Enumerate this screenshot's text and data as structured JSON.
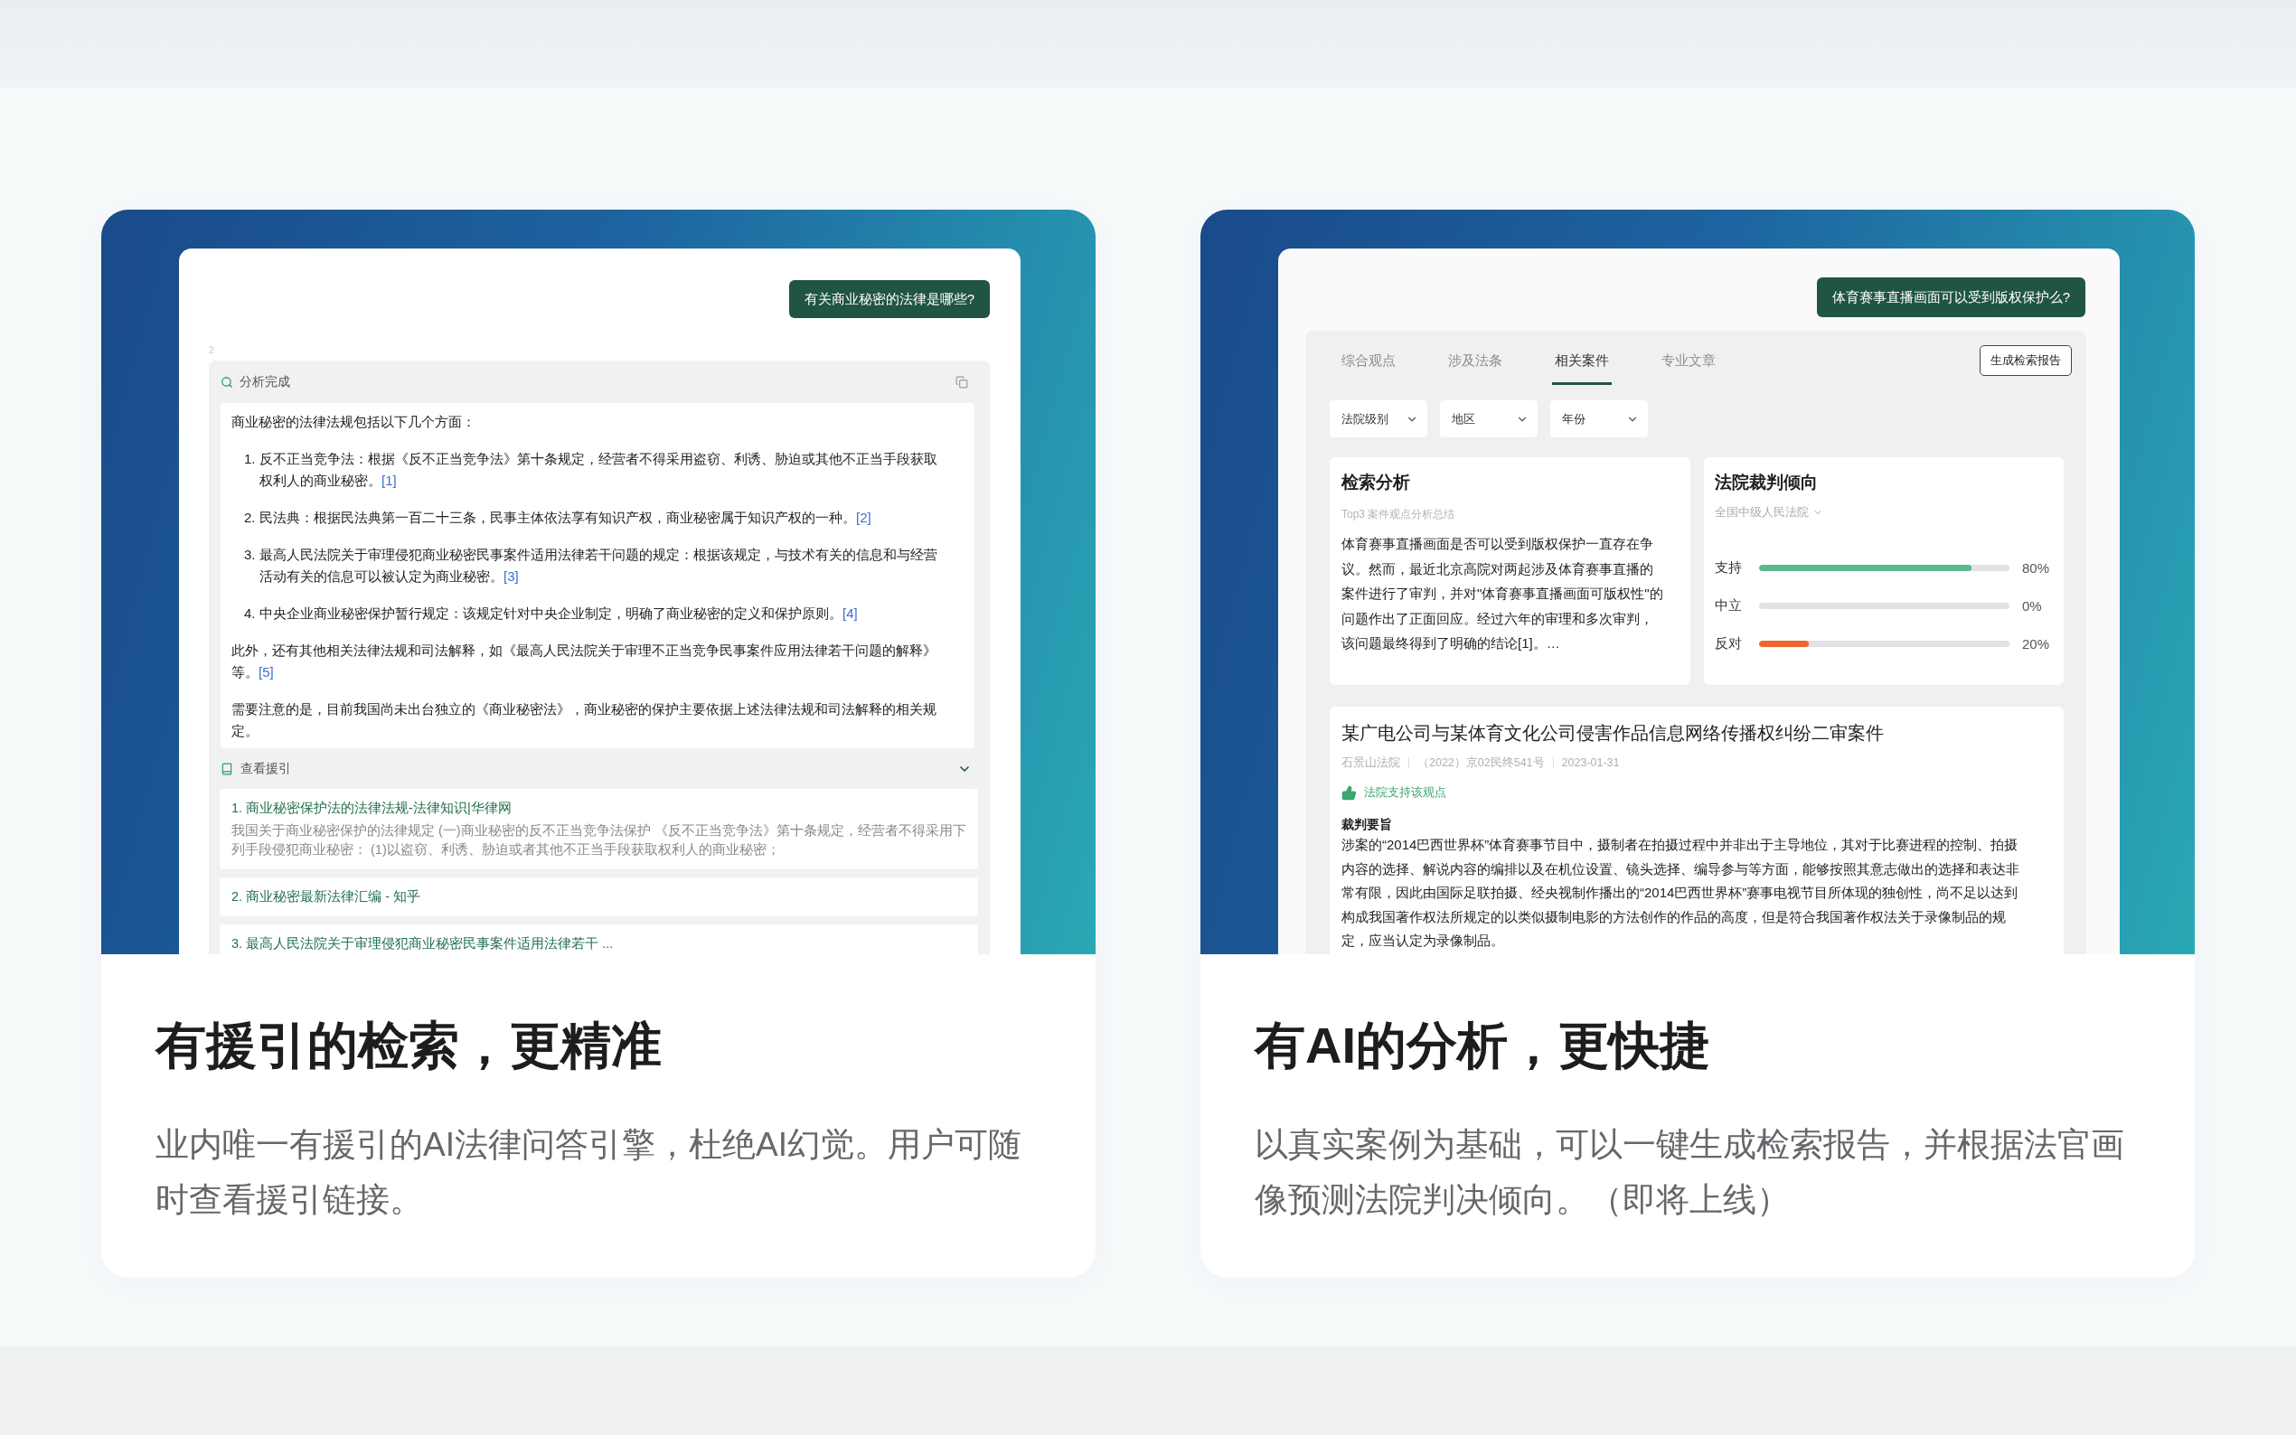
{
  "features": [
    {
      "kind": "chat",
      "screenshot": {
        "question": "有关商业秘密的法律是哪些?",
        "message_index": "2",
        "status": "分析完成",
        "answer": {
          "intro": "商业秘密的法律法规包括以下几个方面：",
          "items": [
            {
              "number": "1.",
              "text": "反不正当竞争法：根据《反不正当竞争法》第十条规定，经营者不得采用盗窃、利诱、胁迫或其他不正当手段获取权利人的商业秘密。",
              "ref": "[1]"
            },
            {
              "number": "2.",
              "text": "民法典：根据民法典第一百二十三条，民事主体依法享有知识产权，商业秘密属于知识产权的一种。",
              "ref": "[2]"
            },
            {
              "number": "3.",
              "text": "最高人民法院关于审理侵犯商业秘密民事案件适用法律若干问题的规定：根据该规定，与技术有关的信息和与经营活动有关的信息可以被认定为商业秘密。",
              "ref": "[3]"
            },
            {
              "number": "4.",
              "text": "中央企业商业秘密保护暂行规定：该规定针对中央企业制定，明确了商业秘密的定义和保护原则。",
              "ref": "[4]"
            }
          ],
          "notes": [
            {
              "text": "此外，还有其他相关法律法规和司法解释，如《最高人民法院关于审理不正当竞争民事案件应用法律若干问题的解释》等。",
              "ref": "[5]"
            },
            {
              "text": "需要注意的是，目前我国尚未出台独立的《商业秘密法》，商业秘密的保护主要依据上述法律法规和司法解释的相关规定。"
            }
          ]
        },
        "citations": {
          "label": "查看援引",
          "expanded": true,
          "items": [
            {
              "title": "1. 商业秘密保护法的法律法规-法律知识|华律网",
              "snippet": "我国关于商业秘密保护的法律规定 (一)商业秘密的反不正当竞争法保护 《反不正当竞争法》第十条规定，经营者不得采用下列手段侵犯商业秘密： (1)以盗窃、利诱、胁迫或者其他不正当手段获取权利人的商业秘密；"
            },
            {
              "title": "2. 商业秘密最新法律汇编 - 知乎"
            },
            {
              "title": "3. 最高人民法院关于审理侵犯商业秘密民事案件适用法律若干 ..."
            }
          ]
        }
      },
      "title": "有援引的检索，更精准",
      "description": "业内唯一有援引的AI法律问答引擎，杜绝AI幻觉。用户可随时查看援引链接。"
    },
    {
      "kind": "cases",
      "screenshot": {
        "question": "体育赛事直播画面可以受到版权保护么?",
        "tabs": [
          {
            "label": "综合观点",
            "selected": false
          },
          {
            "label": "涉及法条",
            "selected": false
          },
          {
            "label": "相关案件",
            "selected": true
          },
          {
            "label": "专业文章",
            "selected": false
          }
        ],
        "report_button": "生成检索报告",
        "filters": [
          "法院级别",
          "地区",
          "年份"
        ],
        "analysis": {
          "title": "检索分析",
          "subtitle": "Top3 案件观点分析总结",
          "text": "体育赛事直播画面是否可以受到版权保护一直存在争议。然而，最近北京高院对两起涉及体育赛事直播的案件进行了审判，并对\"体育赛事直播画面可版权性\"的问题作出了正面回应。经过六年的审理和多次审判，该问题最终得到了明确的结论[1]。…"
        },
        "tendency": {
          "title": "法院裁判倾向",
          "scope": "全国中级人民法院",
          "bars": [
            {
              "label": "支持",
              "level": 0.85,
              "reading": "80%",
              "color": "#5bb98b"
            },
            {
              "label": "中立",
              "reading": "0%"
            },
            {
              "label": "反对",
              "level": 0.2,
              "reading": "20%",
              "color": "#f0652b"
            }
          ]
        },
        "case": {
          "title": "某广电公司与某体育文化公司侵害作品信息网络传播权纠纷二审案件",
          "court": "石景山法院",
          "case_number": "（2022）京02民终541号",
          "date": "2023-01-31",
          "stance": "法院支持该观点",
          "summary_label": "裁判要旨",
          "summary": "涉案的“2014巴西世界杯”体育赛事节目中，摄制者在拍摄过程中并非出于主导地位，其对于比赛进程的控制、拍摄内容的选择、解说内容的编排以及在机位设置、镜头选择、编导参与等方面，能够按照其意志做出的选择和表达非常有限，因此由国际足联拍摄、经央视制作播出的“2014巴西世界杯”赛事电视节目所体现的独创性，尚不足以达到构成我国著作权法所规定的以类似摄制电影的方法创作的作品的高度，但是符合我国著作权法关于录像制品的规定，应当认定为录像制品。"
        }
      },
      "title": "有AI的分析，更快捷",
      "description": "以真实案例为基础，可以一键生成检索报告，并根据法官画像预测法院判决倾向。（即将上线）"
    }
  ]
}
